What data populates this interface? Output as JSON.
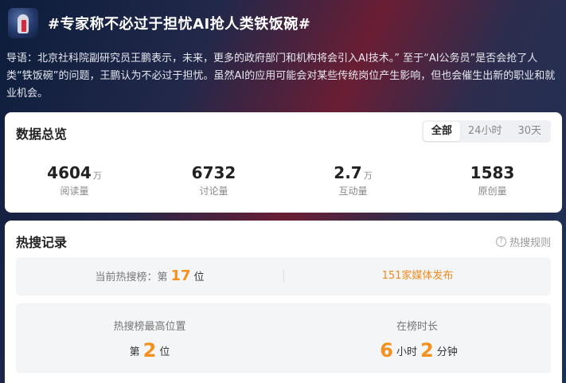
{
  "header": {
    "title": "#专家称不必过于担忧AI抢人类铁饭碗#",
    "logo_icon": "robot-logo-icon"
  },
  "intro": "导语：北京社科院副研究员王鹏表示，未来，更多的政府部门和机构将会引入AI技术。” 至于“AI公务员”是否会抢了人类“铁饭碗”的问题，王鹏认为不必过于担忧。虽然AI的应用可能会对某些传统岗位产生影响，但也会催生出新的职业和就业机会。",
  "overview": {
    "title": "数据总览",
    "tabs": [
      "全部",
      "24小时",
      "30天"
    ],
    "active_tab": "全部",
    "stats": [
      {
        "value": "4604",
        "unit": "万",
        "label": "阅读量"
      },
      {
        "value": "6732",
        "unit": "",
        "label": "讨论量"
      },
      {
        "value": "2.7",
        "unit": "万",
        "label": "互动量"
      },
      {
        "value": "1583",
        "unit": "",
        "label": "原创量"
      }
    ]
  },
  "hot": {
    "title": "热搜记录",
    "rules_label": "热搜规则",
    "rules_icon": "question-circle-icon",
    "current_prefix": "当前热搜榜：第",
    "current_rank": "17",
    "current_suffix": "位",
    "media_link": "151家媒体发布",
    "peak_label": "热搜榜最高位置",
    "peak_prefix": "第",
    "peak_rank": "2",
    "peak_suffix": "位",
    "duration_label": "在榜时长",
    "duration_hours": "6",
    "hours_unit": "小时",
    "duration_minutes": "2",
    "minutes_unit": "分钟"
  },
  "colors": {
    "accent_orange": "#f5901e",
    "bg_navy": "#1a2a4e",
    "bg_crimson": "#6a1e34"
  }
}
